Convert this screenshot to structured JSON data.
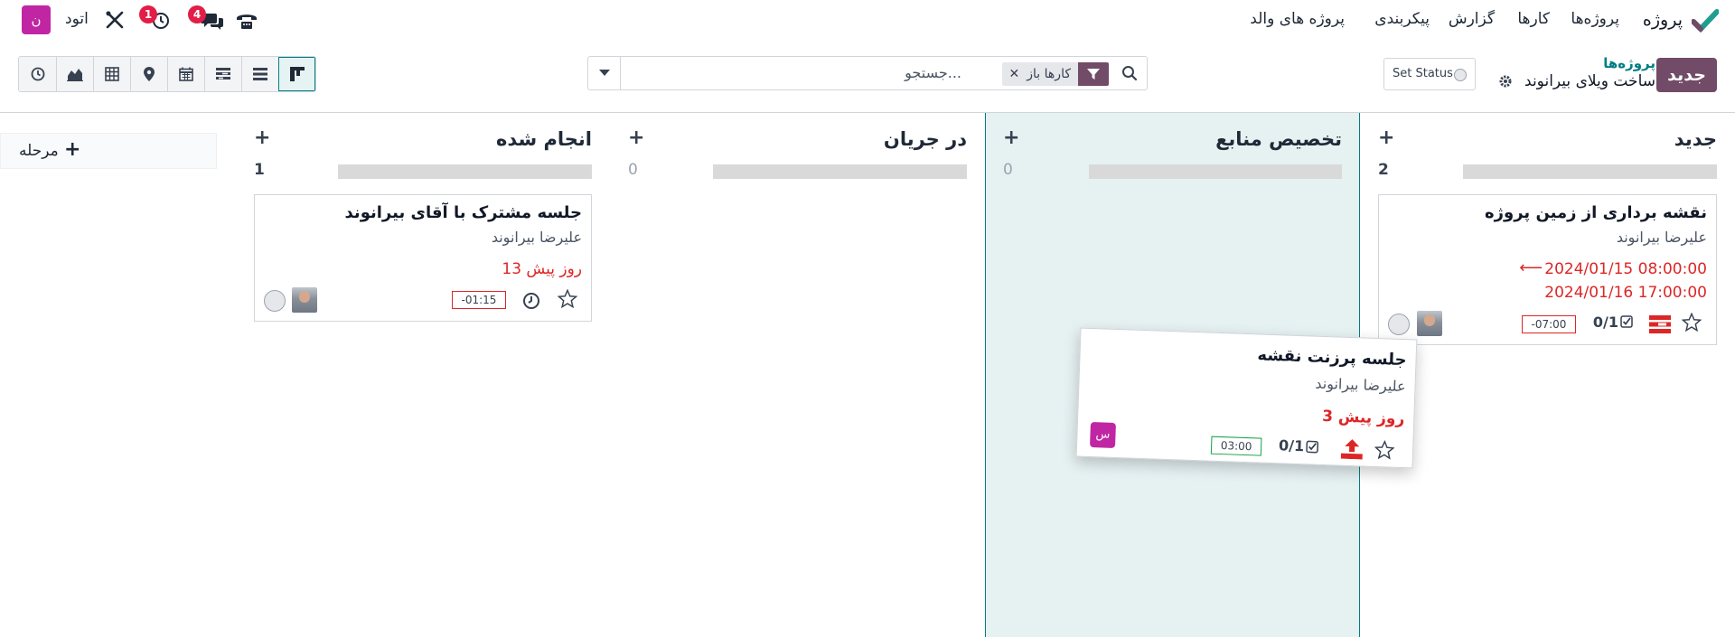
{
  "nav": {
    "app_name": "پروژه",
    "menu": [
      "پروژه‌ها",
      "کارها",
      "گزارش",
      "پیکربندی",
      "پروژه های والد"
    ],
    "company": "اتود",
    "avatar_letter": "ن",
    "badge_messages": "4",
    "badge_activities": "1"
  },
  "control": {
    "new_button": "جدید",
    "breadcrumb_parent": "پروژه‌ها",
    "breadcrumb_current": "ساخت ویلای بیرانوند",
    "set_status": "Set Status",
    "search_facet": "کارها باز",
    "search_placeholder": "جستجو..."
  },
  "columns": [
    {
      "title": "جدید",
      "count": "2"
    },
    {
      "title": "تخصیص منابع",
      "count": "0"
    },
    {
      "title": "در جریان",
      "count": "0"
    },
    {
      "title": "انجام شده",
      "count": "1"
    }
  ],
  "add_stage": "مرحله",
  "cards": {
    "new_card": {
      "title": "نقشه برداری از زمین پروژه",
      "assignee": "علیرضا بیرانوند",
      "date_start": "2024/01/15 08:00:00",
      "date_end": "2024/01/16 17:00:00",
      "subtasks": "0/1",
      "time": "-07:00"
    },
    "done_card": {
      "title": "جلسه مشترک با آقای بیرانوند",
      "assignee": "علیرضا بیرانوند",
      "deadline": "13 روز پیش",
      "time": "-01:15"
    },
    "dragged_card": {
      "title": "جلسه پرزنت نقشه",
      "assignee": "علیرضا بیرانوند",
      "deadline": "3 روز پیش",
      "subtasks": "0/1",
      "time": "03:00",
      "avatar_letter": "س"
    }
  },
  "colors": {
    "brand": "#714b67",
    "accent": "#017e84",
    "danger": "#dc2626",
    "highlight_column": "#e6f1f2"
  }
}
